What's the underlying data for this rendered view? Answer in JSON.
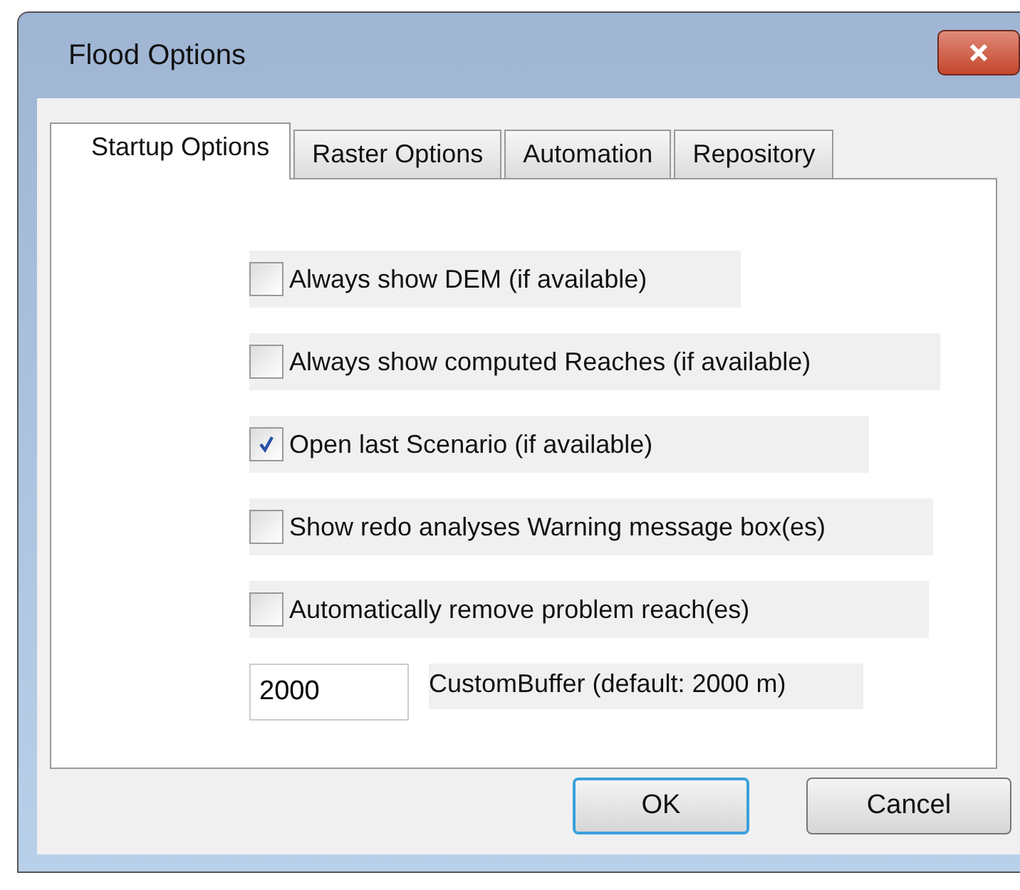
{
  "window": {
    "title": "Flood Options"
  },
  "tabs": [
    {
      "label": "Startup Options",
      "selected": true
    },
    {
      "label": "Raster Options",
      "selected": false
    },
    {
      "label": "Automation",
      "selected": false
    },
    {
      "label": "Repository",
      "selected": false
    }
  ],
  "options": [
    {
      "label": "Always show DEM (if available)",
      "checked": false
    },
    {
      "label": "Always show computed Reaches (if available)",
      "checked": false
    },
    {
      "label": "Open last Scenario (if available)",
      "checked": true
    },
    {
      "label": "Show redo analyses Warning message box(es)",
      "checked": false
    },
    {
      "label": "Automatically remove problem reach(es)",
      "checked": false
    }
  ],
  "buffer": {
    "value": "2000",
    "label": "CustomBuffer (default: 2000 m)"
  },
  "buttons": [
    {
      "label": "OK",
      "default": true
    },
    {
      "label": "Cancel",
      "default": false
    }
  ]
}
